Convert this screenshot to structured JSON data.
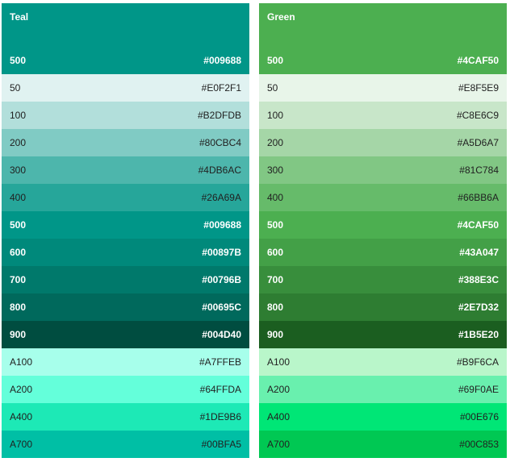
{
  "palettes": [
    {
      "name": "Teal",
      "primary": {
        "shade": "500",
        "hex": "#009688",
        "text": "#ffffff"
      },
      "rows": [
        {
          "shade": "50",
          "hex": "#E0F2F1",
          "text": "#212121",
          "bold": false
        },
        {
          "shade": "100",
          "hex": "#B2DFDB",
          "text": "#212121",
          "bold": false
        },
        {
          "shade": "200",
          "hex": "#80CBC4",
          "text": "#212121",
          "bold": false
        },
        {
          "shade": "300",
          "hex": "#4DB6AC",
          "text": "#212121",
          "bold": false
        },
        {
          "shade": "400",
          "hex": "#26A69A",
          "text": "#212121",
          "bold": false
        },
        {
          "shade": "500",
          "hex": "#009688",
          "text": "#ffffff",
          "bold": true
        },
        {
          "shade": "600",
          "hex": "#00897B",
          "text": "#ffffff",
          "bold": true
        },
        {
          "shade": "700",
          "hex": "#00796B",
          "text": "#ffffff",
          "bold": true
        },
        {
          "shade": "800",
          "hex": "#00695C",
          "text": "#ffffff",
          "bold": true
        },
        {
          "shade": "900",
          "hex": "#004D40",
          "text": "#ffffff",
          "bold": true
        },
        {
          "shade": "A100",
          "hex": "#A7FFEB",
          "text": "#212121",
          "bold": false
        },
        {
          "shade": "A200",
          "hex": "#64FFDA",
          "text": "#212121",
          "bold": false
        },
        {
          "shade": "A400",
          "hex": "#1DE9B6",
          "text": "#212121",
          "bold": false
        },
        {
          "shade": "A700",
          "hex": "#00BFA5",
          "text": "#212121",
          "bold": false
        }
      ]
    },
    {
      "name": "Green",
      "primary": {
        "shade": "500",
        "hex": "#4CAF50",
        "text": "#ffffff"
      },
      "rows": [
        {
          "shade": "50",
          "hex": "#E8F5E9",
          "text": "#212121",
          "bold": false
        },
        {
          "shade": "100",
          "hex": "#C8E6C9",
          "text": "#212121",
          "bold": false
        },
        {
          "shade": "200",
          "hex": "#A5D6A7",
          "text": "#212121",
          "bold": false
        },
        {
          "shade": "300",
          "hex": "#81C784",
          "text": "#212121",
          "bold": false
        },
        {
          "shade": "400",
          "hex": "#66BB6A",
          "text": "#212121",
          "bold": false
        },
        {
          "shade": "500",
          "hex": "#4CAF50",
          "text": "#ffffff",
          "bold": true
        },
        {
          "shade": "600",
          "hex": "#43A047",
          "text": "#ffffff",
          "bold": true
        },
        {
          "shade": "700",
          "hex": "#388E3C",
          "text": "#ffffff",
          "bold": true
        },
        {
          "shade": "800",
          "hex": "#2E7D32",
          "text": "#ffffff",
          "bold": true
        },
        {
          "shade": "900",
          "hex": "#1B5E20",
          "text": "#ffffff",
          "bold": true
        },
        {
          "shade": "A100",
          "hex": "#B9F6CA",
          "text": "#212121",
          "bold": false
        },
        {
          "shade": "A200",
          "hex": "#69F0AE",
          "text": "#212121",
          "bold": false
        },
        {
          "shade": "A400",
          "hex": "#00E676",
          "text": "#212121",
          "bold": false
        },
        {
          "shade": "A700",
          "hex": "#00C853",
          "text": "#212121",
          "bold": false
        }
      ]
    }
  ]
}
